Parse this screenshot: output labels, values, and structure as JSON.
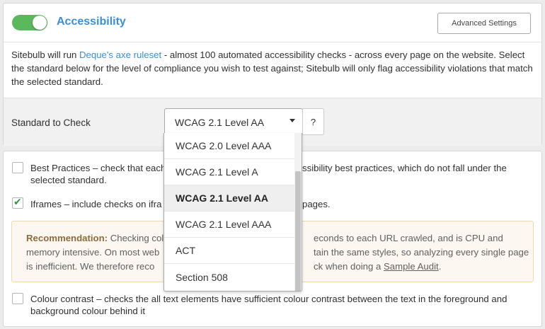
{
  "header": {
    "title": "Accessibility",
    "toggle_on": true,
    "advanced_button": "Advanced Settings"
  },
  "description": {
    "part1": "Sitebulb will run ",
    "link": "Deque's axe ruleset",
    "part2": " - almost 100 automated accessibility checks - across every page on the website. Select the standard below for the level of compliance you wish to test against; Sitebulb will only flag accessibility violations that match the selected standard."
  },
  "standard": {
    "label": "Standard to Check",
    "selected": "WCAG 2.1 Level AA",
    "help": "?",
    "options": [
      "WCAG 2.0 Level AAA",
      "WCAG 2.1 Level A",
      "WCAG 2.1 Level AA",
      "WCAG 2.1 Level AAA",
      "ACT",
      "Section 508"
    ]
  },
  "options": {
    "best_practices": {
      "part1": "Best Practices – check that each",
      "part2": "ssibility best practices, which do not fall under the",
      "part3": "selected standard.",
      "checked": false
    },
    "iframes": {
      "part1": "Iframes – include checks on ifra",
      "part2": "pages.",
      "checked": true
    },
    "colour_contrast": {
      "text": "Colour contrast – checks the all text elements have sufficient colour contrast between the text in the foreground and background colour behind it",
      "checked": false
    }
  },
  "recommendation": {
    "label": "Recommendation:",
    "line1a": " Checking colo",
    "line1b": "econds to each URL crawled, and is CPU and",
    "line2a": "memory intensive. On most web",
    "line2b": "tain the same styles, so analyzing every single page",
    "line3a": "is inefficient. We therefore reco",
    "line3b": "ck when doing a ",
    "link": "Sample Audit",
    "end": "."
  },
  "colors": {
    "accent": "#3b8fd8",
    "toggle": "#5cb85c",
    "check": "#2d9a3e",
    "reco_bg": "#fcf8f1",
    "reco_border": "#f0d8ae"
  }
}
